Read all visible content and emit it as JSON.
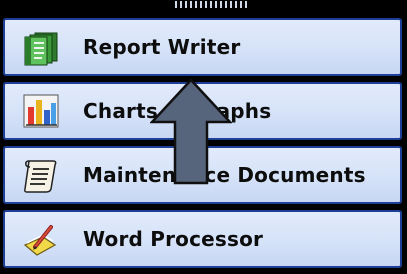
{
  "nav": {
    "items": [
      {
        "label": "Report Writer",
        "icon": "report-writer-icon"
      },
      {
        "label": "Charts & Graphs",
        "icon": "charts-icon"
      },
      {
        "label": "Maintenance Documents",
        "icon": "scroll-document-icon"
      },
      {
        "label": "Word Processor",
        "icon": "pen-paper-icon"
      }
    ]
  },
  "colors": {
    "background": "#000000",
    "item_fill": "#d5e2f8",
    "item_border": "#1d3f95",
    "arrow_fill": "#56647c",
    "arrow_stroke": "#101010"
  }
}
